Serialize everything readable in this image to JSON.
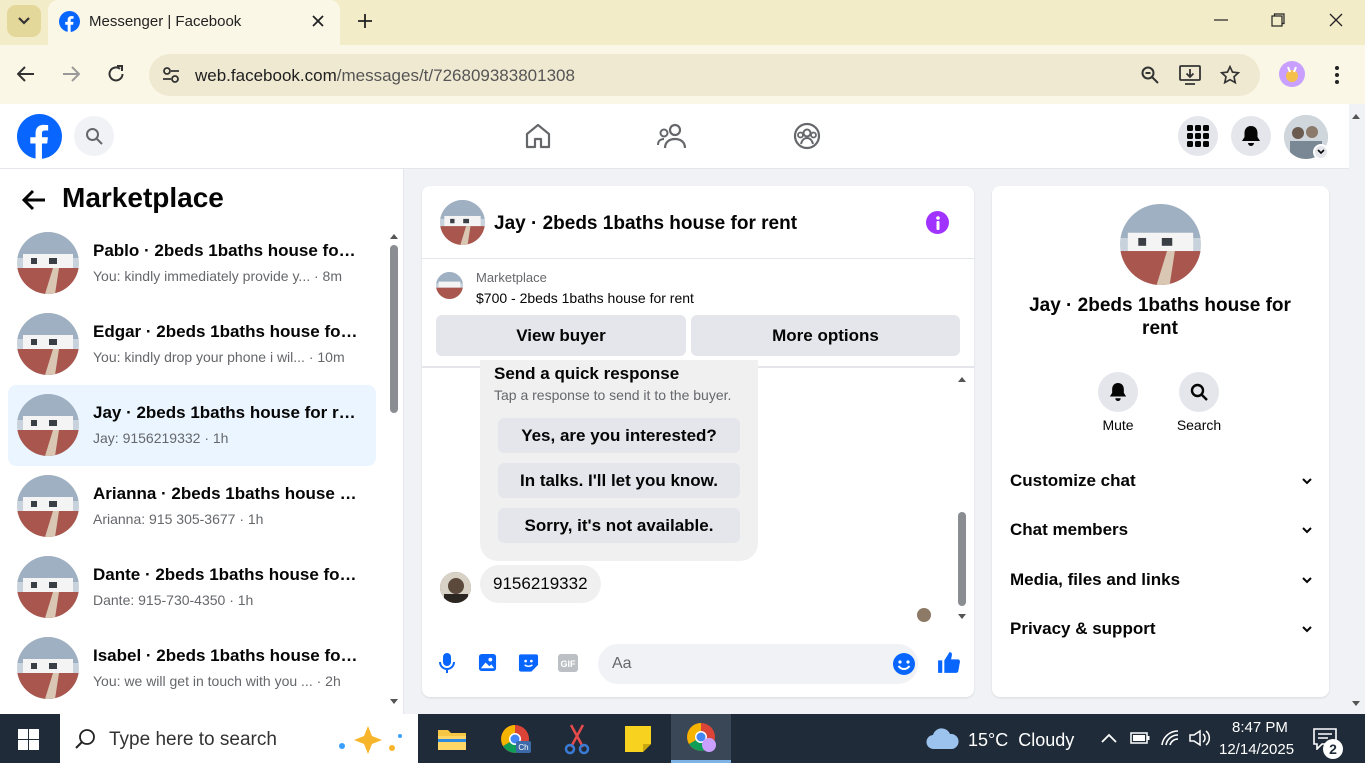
{
  "browser": {
    "tab_title": "Messenger | Facebook",
    "url_host": "web.facebook.com",
    "url_path": "/messages/t/726809383801308"
  },
  "sidebar": {
    "title": "Marketplace",
    "conversations": [
      {
        "name": "Pablo · 2beds 1baths house for r...",
        "preview": "You: kindly immediately provide y...",
        "time": "· 8m",
        "selected": false
      },
      {
        "name": "Edgar · 2beds 1baths house for r...",
        "preview": "You: kindly drop your phone i wil...",
        "time": "· 10m",
        "selected": false
      },
      {
        "name": "Jay · 2beds 1baths house for rent",
        "preview": "Jay: 9156219332",
        "time": "· 1h",
        "selected": true
      },
      {
        "name": "Arianna · 2beds 1baths house fo...",
        "preview": "Arianna: 915 305-3677",
        "time": "· 1h",
        "selected": false
      },
      {
        "name": "Dante · 2beds 1baths house for ...",
        "preview": "Dante: 915-730-4350",
        "time": "· 1h",
        "selected": false
      },
      {
        "name": "Isabel · 2beds 1baths house for r...",
        "preview": "You: we will get in touch with you ...",
        "time": "· 2h",
        "selected": false
      }
    ]
  },
  "chat": {
    "title": "Jay · 2beds 1baths house for rent",
    "listing_label": "Marketplace",
    "listing_text": "$700 - 2beds 1baths house for rent",
    "view_buyer": "View buyer",
    "more_options": "More options",
    "quick_title": "Send a quick response",
    "quick_sub": "Tap a response to send it to the buyer.",
    "quick_responses": [
      "Yes, are you interested?",
      "In talks. I'll let you know.",
      "Sorry, it's not available."
    ],
    "last_message": "9156219332",
    "composer_placeholder": "Aa"
  },
  "info": {
    "name": "Jay · 2beds 1baths house for rent",
    "mute": "Mute",
    "search": "Search",
    "sections": [
      "Customize chat",
      "Chat members",
      "Media, files and links",
      "Privacy & support"
    ]
  },
  "taskbar": {
    "search_placeholder": "Type here to search",
    "weather": "15°C  Cloudy",
    "time": "8:47 PM",
    "date": "12/14/2025",
    "notifications": "2"
  },
  "colors": {
    "fb_blue": "#0866ff",
    "accent_purple": "#a033ff",
    "selected_row": "#ebf5ff"
  }
}
